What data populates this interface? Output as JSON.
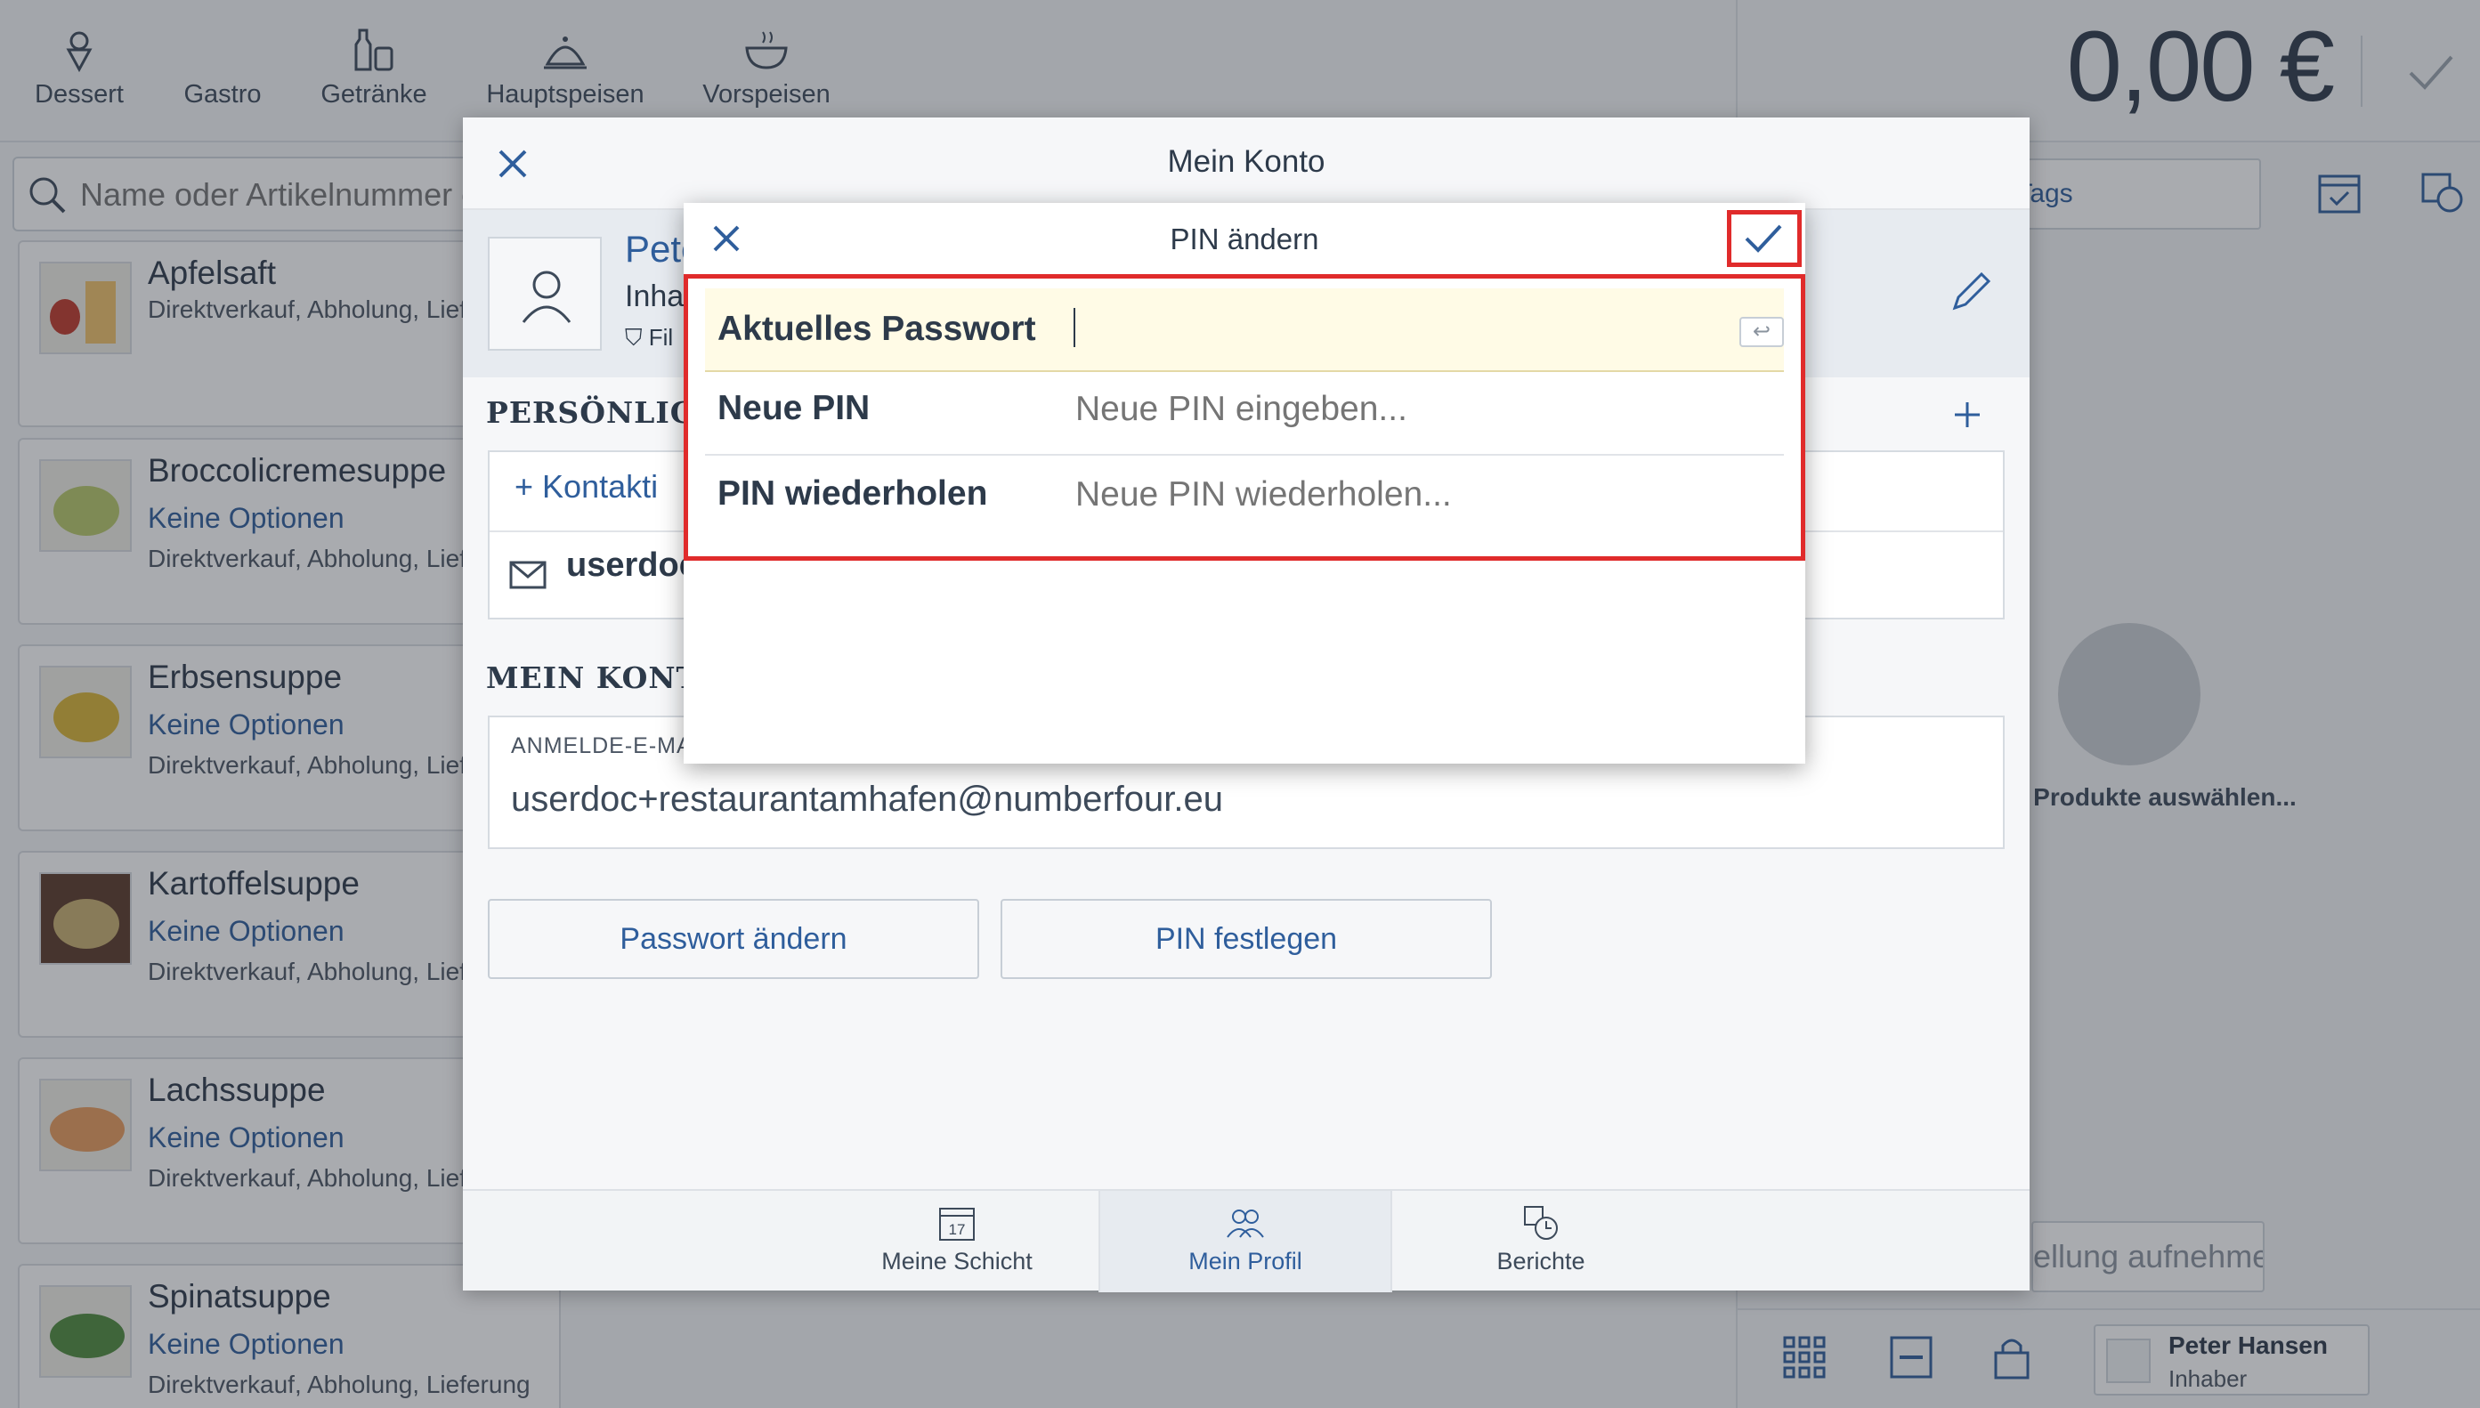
{
  "topbar": {
    "categories": [
      {
        "label": "Dessert",
        "icon": "ice-cream-icon"
      },
      {
        "label": "Gastro",
        "icon": "gastro-icon"
      },
      {
        "label": "Getränke",
        "icon": "bottles-icon"
      },
      {
        "label": "Hauptspeisen",
        "icon": "cloche-icon"
      },
      {
        "label": "Vorspeisen",
        "icon": "soup-bowl-icon"
      }
    ]
  },
  "search": {
    "placeholder": "Name oder Artikelnummer ei"
  },
  "products": [
    {
      "name": "Apfelsaft",
      "options": "",
      "meta": "Direktverkauf, Abholung, Lief"
    },
    {
      "name": "Broccolicremesuppe",
      "options": "Keine Optionen",
      "meta": "Direktverkauf, Abholung, Lief"
    },
    {
      "name": "Erbsensuppe",
      "options": "Keine Optionen",
      "meta": "Direktverkauf, Abholung, Lief"
    },
    {
      "name": "Kartoffelsuppe",
      "options": "Keine Optionen",
      "meta": "Direktverkauf, Abholung, Lief"
    },
    {
      "name": "Lachssuppe",
      "options": "Keine Optionen",
      "meta": "Direktverkauf, Abholung, Lief"
    },
    {
      "name": "Spinatsuppe",
      "options": "Keine Optionen",
      "meta": "Direktverkauf, Abholung, Lieferung"
    }
  ],
  "right_panel": {
    "total": "0,00 €",
    "tags_label": "+ Tags",
    "empty_hint": "Produkte auswählen...",
    "order_button": "ellung aufnehmen",
    "user_name": "Peter Hansen",
    "user_role": "Inhaber"
  },
  "konto": {
    "title": "Mein Konto",
    "profile_name": "Pete",
    "profile_role": "Inha",
    "profile_branch": "Fil",
    "personal_section": "PERSÖNLICHE",
    "add_contact": "Kontakti",
    "email_short": "userdoc",
    "account_section": "MEIN KONTO",
    "login_email_label": "ANMELDE-E-MAI",
    "login_email": "userdoc+restaurantamhafen@numberfour.eu",
    "change_password": "Passwort ändern",
    "set_pin": "PIN festlegen",
    "footer_tabs": [
      {
        "label": "Meine Schicht",
        "icon": "calendar-icon",
        "day": "17"
      },
      {
        "label": "Mein Profil",
        "icon": "profile-icon"
      },
      {
        "label": "Berichte",
        "icon": "reports-icon"
      }
    ]
  },
  "pin_dialog": {
    "title": "PIN ändern",
    "current_password_label": "Aktuelles Passwort",
    "current_password_value": "",
    "new_pin_label": "Neue PIN",
    "new_pin_placeholder": "Neue PIN eingeben...",
    "repeat_pin_label": "PIN wiederholen",
    "repeat_pin_placeholder": "Neue PIN wiederholen..."
  },
  "colors": {
    "accent": "#2f5e9c",
    "highlight": "#e02b2b",
    "active_field": "#fffbe6"
  }
}
